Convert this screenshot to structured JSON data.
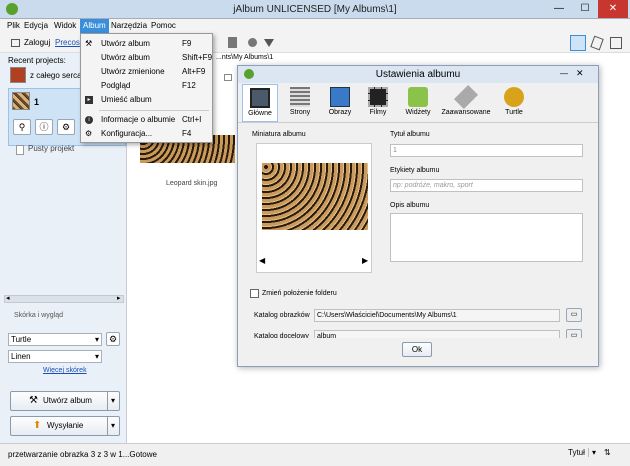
{
  "window": {
    "title": "jAlbum UNLICENSED [My Albums\\1]",
    "controls": {
      "minimize": "—",
      "maximize": "☐",
      "close": "✕"
    },
    "colors": {
      "close_button": "#c7372f",
      "accent": "#3a8fdb"
    }
  },
  "menubar": [
    "Plik",
    "Edycja",
    "Widok",
    "Album",
    "Narzędzia",
    "Pomoc"
  ],
  "toolbar": {
    "login": "Zaloguj",
    "prices": "Precos",
    "breadcrumb": "...nts\\My Albums\\1"
  },
  "album_menu": {
    "items": [
      {
        "icon": "hammer-icon",
        "label": "Utwórz album",
        "shortcut": "F9"
      },
      {
        "icon": "",
        "label": "Utwórz album",
        "shortcut": "Shift+F9"
      },
      {
        "icon": "",
        "label": "Utwórz zmienione",
        "shortcut": "Alt+F9"
      },
      {
        "icon": "",
        "label": "Podgląd",
        "shortcut": "F12"
      },
      {
        "icon": "upload-icon",
        "label": "Umieść album",
        "shortcut": ""
      },
      {
        "icon": "info-icon",
        "label": "Informacje o albumie",
        "shortcut": "Ctrl+I"
      },
      {
        "icon": "gear-icon",
        "label": "Konfiguracja...",
        "shortcut": "F4"
      }
    ]
  },
  "sidebar": {
    "recent_label": "Recent projects:",
    "projects": [
      {
        "name": "z całego serca p"
      },
      {
        "name": "1"
      }
    ],
    "empty_project": "Pusty projekt",
    "skin_section": "Skórka i wygląd",
    "skin": "Turtle",
    "style": "Linen",
    "more_skins": "Więcej skórek",
    "make_album": "Utwórz album",
    "upload": "Wysyłanie"
  },
  "content": {
    "image_caption": "Leopard skin.jpg"
  },
  "dialog": {
    "title": "Ustawienia albumu",
    "tabs": [
      "Główne",
      "Strony",
      "Obrazy",
      "Filmy",
      "Widżety",
      "Zaawansowane",
      "Turtle"
    ],
    "active_tab": "Główne",
    "thumbnail_label": "Miniatura albumu",
    "title_label": "Tytuł albumu",
    "title_value": "1",
    "tags_label": "Etykiety albumu",
    "tags_placeholder": "np: podróże, makro, sport",
    "description_label": "Opis albumu",
    "description_value": "",
    "change_folder_label": "Zmień położenie folderu",
    "images_dir_label": "Katalog obrazków",
    "images_dir_value": "C:\\Users\\Właściciel\\Documents\\My Albums\\1",
    "target_dir_label": "Katalog docelowy",
    "target_dir_value": "album",
    "ok": "Ok",
    "prev_arrow": "◀",
    "next_arrow": "▶"
  },
  "statusbar": {
    "message": "przetwarzanie obrazka 3 z 3 w 1...Gotowe",
    "sort": "Tytuł"
  }
}
